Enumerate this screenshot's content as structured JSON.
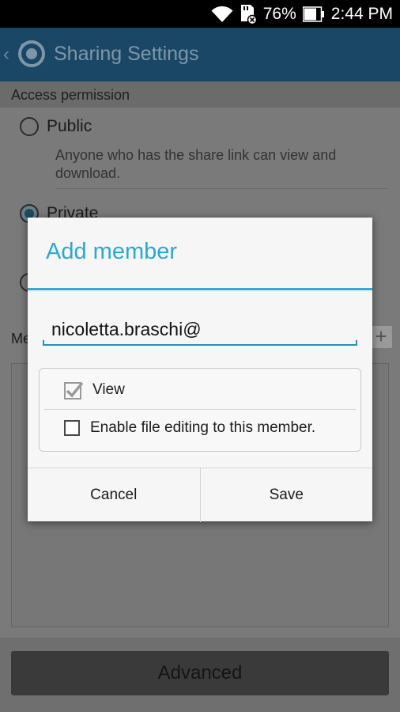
{
  "status_bar": {
    "battery": "76%",
    "time": "2:44 PM",
    "icons": [
      "wifi-icon",
      "sd-card-icon",
      "battery-icon"
    ]
  },
  "action_bar": {
    "title": "Sharing Settings",
    "icons": [
      "back-chevron-icon",
      "app-icon"
    ]
  },
  "access": {
    "header": "Access permission",
    "options": [
      {
        "label": "Public",
        "description": "Anyone who has the share link can view and download.",
        "selected": false
      },
      {
        "label": "Private",
        "selected": true
      }
    ]
  },
  "members": {
    "header_partial": "Me",
    "add_icon": "plus-icon"
  },
  "bottom": {
    "advanced_label": "Advanced"
  },
  "dialog": {
    "title": "Add member",
    "input_value": "nicoletta.braschi@",
    "options": [
      {
        "label": "View",
        "checked": true
      },
      {
        "label": "Enable file editing to this member.",
        "checked": false
      }
    ],
    "cancel_label": "Cancel",
    "save_label": "Save"
  },
  "colors": {
    "accent": "#2ba8cf",
    "action_bar": "#1b4766",
    "status_bar": "#000000"
  }
}
